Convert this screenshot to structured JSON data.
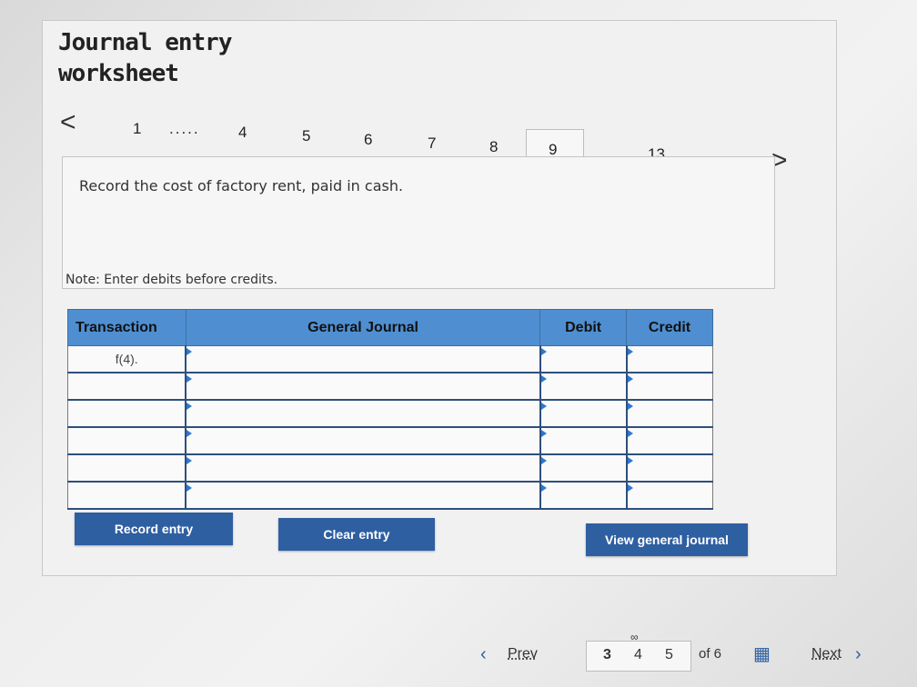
{
  "header": {
    "title_line1": "Journal entry",
    "title_line2": "worksheet"
  },
  "steps": {
    "prev_arrow": "<",
    "next_arrow": ">",
    "items": [
      "1",
      ".....",
      "4",
      "5",
      "6",
      "7",
      "8",
      "9",
      "....",
      "13"
    ],
    "active": "9"
  },
  "question": {
    "text": "Record the cost of factory rent, paid in cash."
  },
  "note": "Note: Enter debits before credits.",
  "table": {
    "headers": [
      "Transaction",
      "General Journal",
      "Debit",
      "Credit"
    ],
    "rows": [
      [
        "f(4).",
        "",
        "",
        ""
      ],
      [
        "",
        "",
        "",
        ""
      ],
      [
        "",
        "",
        "",
        ""
      ],
      [
        "",
        "",
        "",
        ""
      ],
      [
        "",
        "",
        "",
        ""
      ],
      [
        "",
        "",
        "",
        ""
      ]
    ]
  },
  "buttons": {
    "record": "Record entry",
    "clear": "Clear entry",
    "view": "View general journal"
  },
  "pagination": {
    "prev": "Prev",
    "pages": [
      "3",
      "4",
      "5"
    ],
    "of": "of 6",
    "next": "Next"
  }
}
